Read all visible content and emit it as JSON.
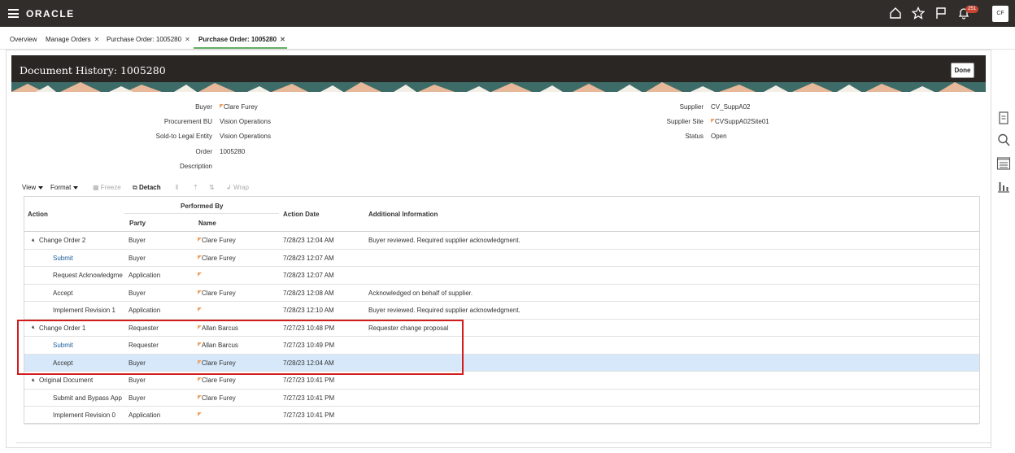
{
  "app": {
    "logo": "ORACLE",
    "notification_count": "251",
    "user_initials": "CF"
  },
  "tabs": [
    {
      "label": "Overview",
      "closable": false
    },
    {
      "label": "Manage Orders",
      "closable": true
    },
    {
      "label": "Purchase Order: 1005280",
      "closable": true
    },
    {
      "label": "Purchase Order: 1005280",
      "closable": true,
      "active": true
    }
  ],
  "page": {
    "title": "Document History: 1005280",
    "done_label": "Done"
  },
  "fields": {
    "buyer_label": "Buyer",
    "buyer": "Clare Furey",
    "procurement_bu_label": "Procurement BU",
    "procurement_bu": "Vision Operations",
    "sold_to_label": "Sold-to Legal Entity",
    "sold_to": "Vision Operations",
    "order_label": "Order",
    "order": "1005280",
    "description_label": "Description",
    "description": "",
    "supplier_label": "Supplier",
    "supplier": "CV_SuppA02",
    "supplier_site_label": "Supplier Site",
    "supplier_site": "CVSuppA02Site01",
    "status_label": "Status",
    "status": "Open"
  },
  "toolbar": {
    "view": "View",
    "format": "Format",
    "freeze": "Freeze",
    "detach": "Detach",
    "wrap": "Wrap"
  },
  "table": {
    "headers": {
      "action": "Action",
      "performed_by": "Performed By",
      "party": "Party",
      "name": "Name",
      "action_date": "Action Date",
      "additional_info": "Additional Information"
    },
    "rows": [
      {
        "action": "Change Order 2",
        "parent": true,
        "party": "Buyer",
        "name": "Clare Furey",
        "date": "7/28/23 12:04 AM",
        "info": "Buyer reviewed. Required supplier acknowledgment."
      },
      {
        "action": "Submit",
        "link": true,
        "party": "Buyer",
        "name": "Clare Furey",
        "date": "7/28/23 12:07 AM",
        "info": ""
      },
      {
        "action": "Request Acknowledgme",
        "party": "Application",
        "name": "",
        "date": "7/28/23 12:07 AM",
        "info": ""
      },
      {
        "action": "Accept",
        "party": "Buyer",
        "name": "Clare Furey",
        "date": "7/28/23 12:08 AM",
        "info": "Acknowledged on behalf of supplier."
      },
      {
        "action": "Implement Revision 1",
        "party": "Application",
        "name": "",
        "date": "7/28/23 12:10 AM",
        "info": "Buyer reviewed. Required supplier acknowledgment."
      },
      {
        "action": "Change Order 1",
        "parent": true,
        "party": "Requester",
        "name": "Allan Barcus",
        "date": "7/27/23 10:48 PM",
        "info": "Requester change proposal"
      },
      {
        "action": "Submit",
        "link": true,
        "party": "Requester",
        "name": "Allan Barcus",
        "date": "7/27/23 10:49 PM",
        "info": ""
      },
      {
        "action": "Accept",
        "party": "Buyer",
        "name": "Clare Furey",
        "date": "7/28/23 12:04 AM",
        "info": "",
        "selected": true
      },
      {
        "action": "Original Document",
        "parent": true,
        "party": "Buyer",
        "name": "Clare Furey",
        "date": "7/27/23 10:41 PM",
        "info": ""
      },
      {
        "action": "Submit and Bypass App",
        "party": "Buyer",
        "name": "Clare Furey",
        "date": "7/27/23 10:41 PM",
        "info": ""
      },
      {
        "action": "Implement Revision 0",
        "party": "Application",
        "name": "",
        "date": "7/27/23 10:41 PM",
        "info": ""
      }
    ]
  },
  "colors": {
    "topbar": "#312d2a",
    "link": "#1a5f99",
    "selected_row": "#d6e8f9",
    "highlight_box": "#d11d1d",
    "badge": "#c74634"
  }
}
